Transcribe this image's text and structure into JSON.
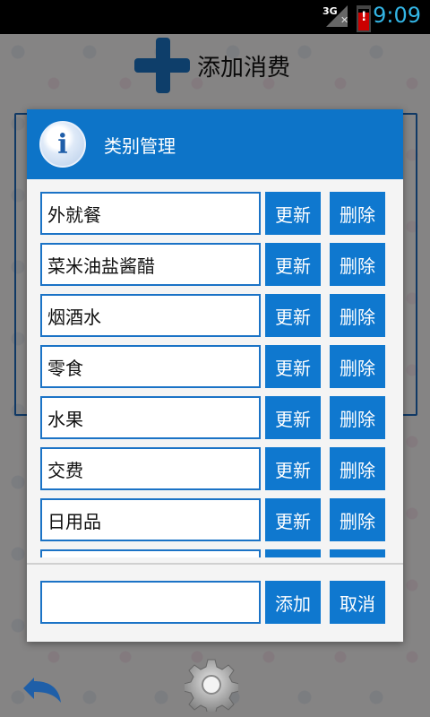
{
  "status": {
    "network": "3G",
    "time": "9:09",
    "battery_alert": "!"
  },
  "header": {
    "title": "添加消费"
  },
  "dialog": {
    "title": "类别管理",
    "items": [
      {
        "name": "外就餐",
        "update": "更新",
        "delete": "删除"
      },
      {
        "name": "菜米油盐酱醋",
        "update": "更新",
        "delete": "删除"
      },
      {
        "name": "烟酒水",
        "update": "更新",
        "delete": "删除"
      },
      {
        "name": "零食",
        "update": "更新",
        "delete": "删除"
      },
      {
        "name": "水果",
        "update": "更新",
        "delete": "删除"
      },
      {
        "name": "交费",
        "update": "更新",
        "delete": "删除"
      },
      {
        "name": "日用品",
        "update": "更新",
        "delete": "删除"
      }
    ],
    "add_input_value": "",
    "add_label": "添加",
    "cancel_label": "取消"
  },
  "icons": {
    "info": "info-icon",
    "back": "undo-icon",
    "settings": "gear-icon"
  },
  "colors": {
    "accent": "#0f78cf",
    "header": "#0d74c8",
    "status_clock": "#33b5e5"
  }
}
